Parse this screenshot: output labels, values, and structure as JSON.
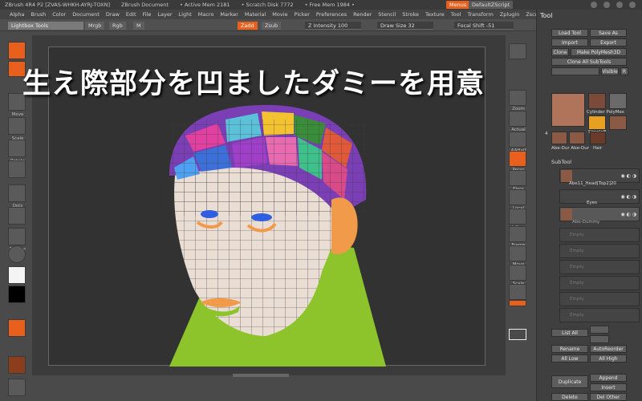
{
  "titlebar": {
    "app": "ZBrush 4R4 P2 [ZVAS-WHKH-AYRJ-TOXN]",
    "document": "ZBrush Document",
    "active_mem": "• Active Mem 2181",
    "scratch_disk": "• Scratch Disk 7772",
    "free_mem": "• Free Mem 1984 •",
    "menus_label": "Menus",
    "script_label": "DefaultZScript"
  },
  "menubar": {
    "items": [
      "Alpha",
      "Brush",
      "Color",
      "Document",
      "Draw",
      "Edit",
      "File",
      "Layer",
      "Light",
      "Macro",
      "Marker",
      "Material",
      "Movie",
      "Picker",
      "Preferences",
      "Render",
      "Stencil",
      "Stroke",
      "Texture",
      "Tool",
      "Transform",
      "Zplugin",
      "Zscript"
    ]
  },
  "shelf": {
    "lightbox": "Lightbox Tools",
    "mrgb": "Mrgb",
    "rgb": "Rgb",
    "m": "M",
    "zadd": "Zadd",
    "zsub": "Zsub",
    "z_intensity": "Z Intensity 100",
    "draw_size": "Draw Size 32",
    "focal_shift": "Focal Shift -51"
  },
  "caption": "生え際部分を凹ましたダミーを用意",
  "left_tools": {
    "labels": [
      "Edit",
      "Draw",
      "Move",
      "Scale",
      "Rotate",
      "",
      "Dots",
      "",
      "Texture",
      "Material"
    ]
  },
  "right_tools": {
    "labels": [
      "",
      "Zoom",
      "Actual",
      "AAHalf",
      "Persp",
      "Floor",
      "Local",
      "L.Sym",
      "Frame",
      "Move",
      "Scale",
      "Rotate",
      "",
      "Transp",
      "Ghost",
      "Xpose"
    ]
  },
  "palette": {
    "title": "Tool",
    "buttons": {
      "load_tool": "Load Tool",
      "save_as": "Save As",
      "import": "Import",
      "export": "Export",
      "clone": "Clone",
      "make_polymesh": "Make PolyMesh3D",
      "clone_all_subtools": "Clone All SubTools",
      "visible": "Visible",
      "r": "R"
    },
    "thumbs": [
      {
        "label": "Cylinder PolyMes"
      },
      {
        "label": "SimpleB"
      },
      {
        "label": "Abe-Dur Abe-Dur"
      },
      {
        "label": "Hair"
      }
    ],
    "thumb_count": "4",
    "subtool_header": "SubTool",
    "subtools": [
      {
        "name": "Abe11_Head[Top2]20",
        "icons": "◉ ◐ ◑"
      },
      {
        "name": "Eyes",
        "icons": "◉ ◐ ◑"
      },
      {
        "name": "Abe-Dummy",
        "icons": "◉ ◐ ◑"
      }
    ],
    "empty_label": "Empty",
    "list_all": "List All",
    "rename": "Rename",
    "autoreorder": "AutoReorder",
    "all_low": "All Low",
    "all_high": "All High",
    "duplicate": "Duplicate",
    "append": "Append",
    "insert": "Insert",
    "delete": "Delete",
    "del_other": "Del Other"
  },
  "colors": {
    "accent": "#e8601c",
    "panel_bg": "#3f3f3f",
    "canvas_bg": "#323232",
    "mesh_green": "#8ec42b",
    "skin": "#e9ddd4"
  }
}
